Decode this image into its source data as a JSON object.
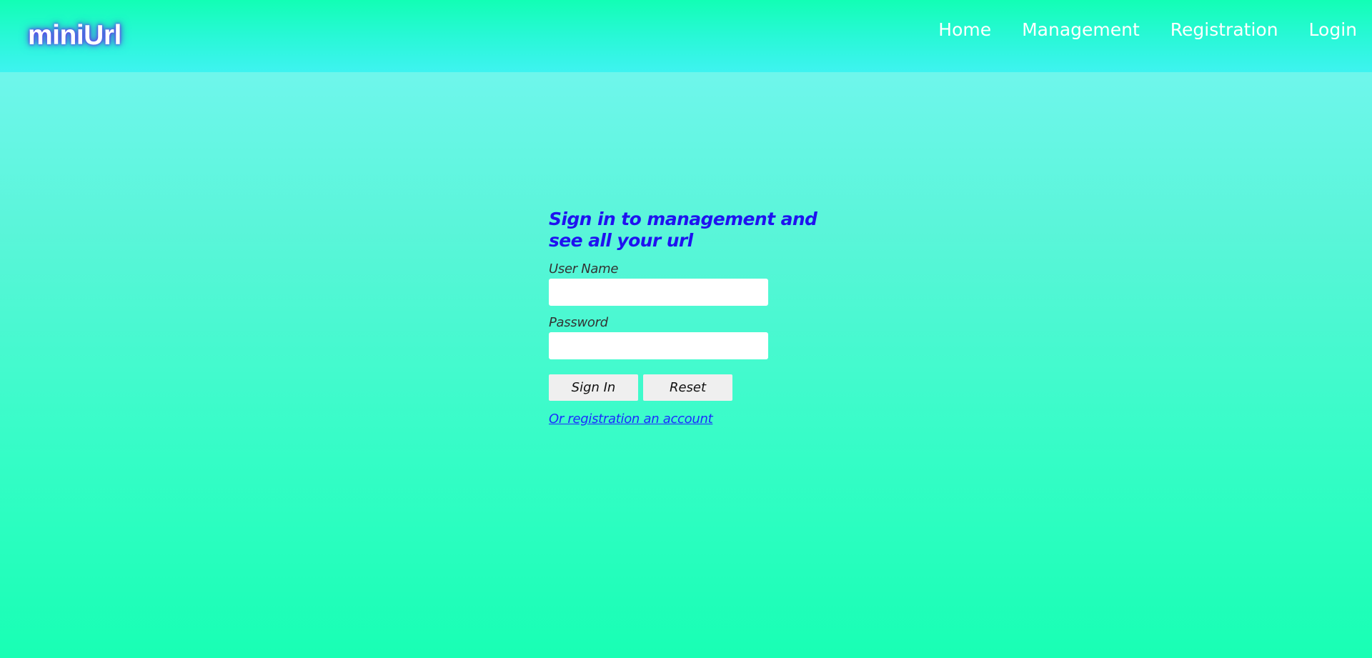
{
  "brand": {
    "name": "miniUrl"
  },
  "nav": {
    "items": [
      {
        "label": "Home"
      },
      {
        "label": "Management"
      },
      {
        "label": "Registration"
      },
      {
        "label": "Login"
      }
    ]
  },
  "login": {
    "heading": "Sign in to management and see all your url",
    "username_label": "User Name",
    "username_value": "",
    "password_label": "Password",
    "password_value": "",
    "sign_in_label": "Sign In",
    "reset_label": "Reset",
    "register_link": "Or registration an account"
  },
  "colors": {
    "heading": "#1f12f0",
    "link": "#1b2bff",
    "nav_text": "#ffffff",
    "brand_glow": "#6a2cff",
    "background_top": "#78f7f4",
    "background_bottom": "#18ffb4"
  }
}
